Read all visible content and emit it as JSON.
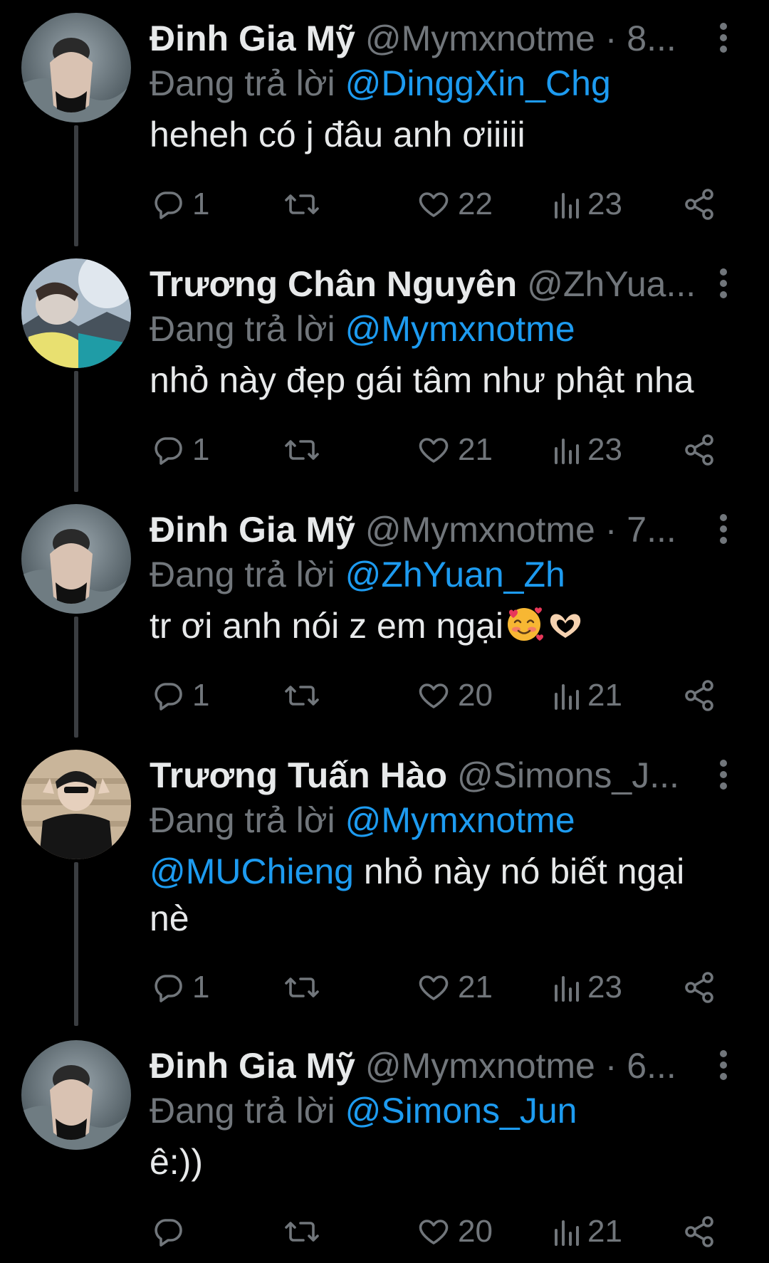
{
  "colors": {
    "background": "#000000",
    "text": "#e7e9ea",
    "muted": "#71767b",
    "accent": "#1d9bf0",
    "thread_line": "#3a3d41"
  },
  "tweets": [
    {
      "name": "Đinh Gia Mỹ",
      "handle": "@Mymxnotme · 8...",
      "reply_prefix": "Đang trả lời ",
      "reply_to": "@DinggXin_Chg",
      "body_mention": "",
      "body": "heheh có j đâu anh ơiiiii",
      "replies": "1",
      "likes": "22",
      "views": "23"
    },
    {
      "name": "Trương Chân Nguyên",
      "handle": "@ZhYua...",
      "reply_prefix": "Đang trả lời ",
      "reply_to": "@Mymxnotme",
      "body_mention": "",
      "body": "nhỏ này đẹp gái tâm như phật nha",
      "replies": "1",
      "likes": "21",
      "views": "23"
    },
    {
      "name": "Đinh Gia Mỹ",
      "handle": "@Mymxnotme · 7...",
      "reply_prefix": "Đang trả lời ",
      "reply_to": "@ZhYuan_Zh",
      "body_mention": "",
      "body": "tr ơi anh nói z em ngại",
      "body_emojis": [
        "smiling-face-with-hearts-emoji",
        "heart-hands-emoji"
      ],
      "replies": "1",
      "likes": "20",
      "views": "21"
    },
    {
      "name": "Trương Tuấn Hào",
      "handle": "@Simons_J...",
      "reply_prefix": "Đang trả lời ",
      "reply_to": "@Mymxnotme",
      "body_mention": "@MUChieng",
      "body": " nhỏ này nó biết ngại nè",
      "replies": "1",
      "likes": "21",
      "views": "23"
    },
    {
      "name": "Đinh Gia Mỹ",
      "handle": "@Mymxnotme · 6...",
      "reply_prefix": "Đang trả lời ",
      "reply_to": "@Simons_Jun",
      "body_mention": "",
      "body": "ê:))",
      "replies": "",
      "likes": "20",
      "views": "21"
    }
  ],
  "icons": {
    "reply": "reply-icon",
    "retweet": "retweet-icon",
    "like": "heart-icon",
    "views": "views-icon",
    "share": "share-icon",
    "more": "more-vertical-icon"
  }
}
